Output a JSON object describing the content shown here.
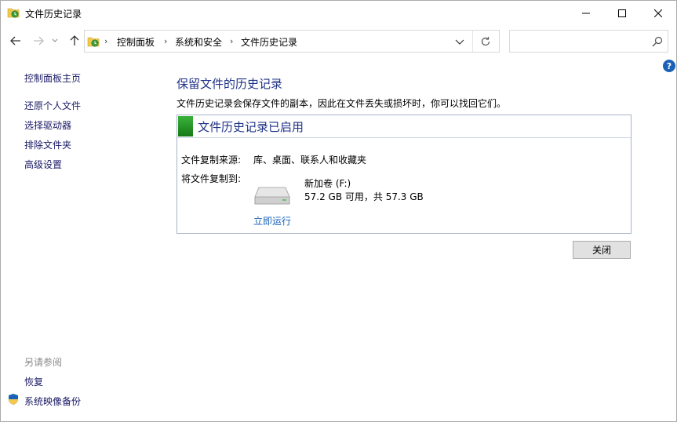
{
  "window": {
    "title": "文件历史记录",
    "controls": {
      "minimize": "minimize-icon",
      "maximize": "maximize-icon",
      "close": "close-icon"
    }
  },
  "address": {
    "breadcrumbs": [
      "控制面板",
      "系统和安全",
      "文件历史记录"
    ],
    "search_placeholder": ""
  },
  "help": {
    "label": "?"
  },
  "sidebar": {
    "home": "控制面板主页",
    "items": [
      "还原个人文件",
      "选择驱动器",
      "排除文件夹",
      "高级设置"
    ],
    "see_also_title": "另请参阅",
    "see_also": [
      "恢复",
      "系统映像备份"
    ]
  },
  "main": {
    "heading": "保留文件的历史记录",
    "description": "文件历史记录会保存文件的副本，因此在文件丢失或损坏时，你可以找回它们。",
    "panel": {
      "status_title": "文件历史记录已启用",
      "status_color": "#2aa52a",
      "source_label": "文件复制来源:",
      "source_value": "库、桌面、联系人和收藏夹",
      "target_label": "将文件复制到:",
      "drive_name": "新加卷 (F:)",
      "drive_space": "57.2 GB 可用，共 57.3 GB",
      "run_now": "立即运行"
    },
    "close_button": "关闭"
  }
}
